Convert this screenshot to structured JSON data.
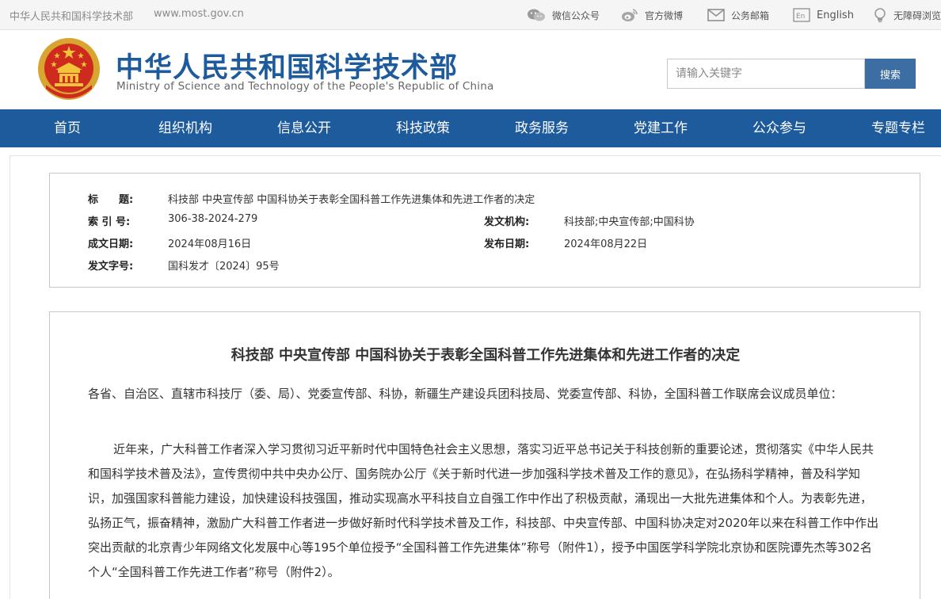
{
  "topbar": {
    "site_name": "中华人民共和国科学技术部",
    "site_url": "www.most.gov.cn",
    "links": {
      "wechat": "微信公众号",
      "weibo": "官方微博",
      "mail": "公务邮箱",
      "english": "English",
      "accessibility": "无障碍浏览"
    }
  },
  "header": {
    "title_cn": "中华人民共和国科学技术部",
    "title_en": "Ministry of Science and Technology of the People's Republic of China",
    "search_placeholder": "请输入关键字",
    "search_button": "搜索"
  },
  "nav": [
    "首页",
    "组织机构",
    "信息公开",
    "科技政策",
    "政务服务",
    "党建工作",
    "公众参与",
    "专题专栏"
  ],
  "metadata": {
    "title_label": "标　　题:",
    "title_value": "科技部 中央宣传部 中国科协关于表彰全国科普工作先进集体和先进工作者的决定",
    "index_label": "索 引 号:",
    "index_value": "306-38-2024-279",
    "issuer_label": "发文机构:",
    "issuer_value": "科技部;中央宣传部;中国科协",
    "created_label": "成文日期:",
    "created_value": "2024年08月16日",
    "published_label": "发布日期:",
    "published_value": "2024年08月22日",
    "docno_label": "发文字号:",
    "docno_value": "国科发才〔2024〕95号"
  },
  "article": {
    "title": "科技部 中央宣传部 中国科协关于表彰全国科普工作先进集体和先进工作者的决定",
    "greeting": "各省、自治区、直辖市科技厅（委、局）、党委宣传部、科协，新疆生产建设兵团科技局、党委宣传部、科协，全国科普工作联席会议成员单位：",
    "paragraph": "近年来，广大科普工作者深入学习贯彻习近平新时代中国特色社会主义思想，落实习近平总书记关于科技创新的重要论述，贯彻落实《中华人民共和国科学技术普及法》，宣传贯彻中共中央办公厅、国务院办公厅《关于新时代进一步加强科学技术普及工作的意见》，在弘扬科学精神，普及科学知识，加强国家科普能力建设，加快建设科技强国，推动实现高水平科技自立自强工作中作出了积极贡献，涌现出一大批先进集体和个人。为表彰先进，弘扬正气，振奋精神，激励广大科普工作者进一步做好新时代科学技术普及工作，科技部、中央宣传部、中国科协决定对2020年以来在科普工作中作出突出贡献的北京青少年网络文化发展中心等195个单位授予“全国科普工作先进集体”称号（附件1），授予中国医学科学院北京协和医院谭先杰等302名个人“全国科普工作先进工作者”称号（附件2）。"
  }
}
